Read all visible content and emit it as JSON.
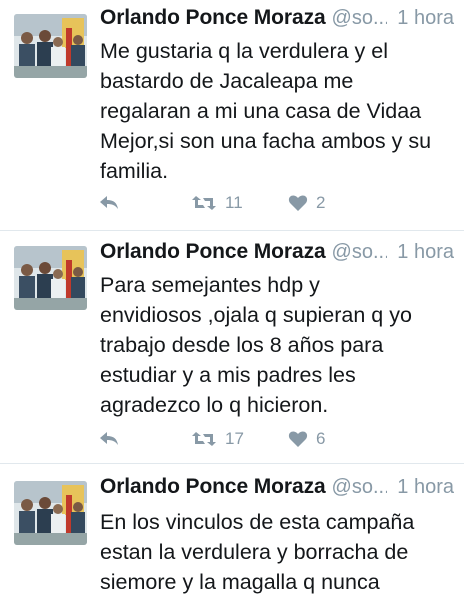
{
  "tweets": [
    {
      "name": "Orlando Ponce Moraza",
      "handle": "@so...",
      "time": "1 hora",
      "lines": [
        "Me gustaria q la verdulera y el",
        "bastardo de Jacaleapa me",
        "regalaran a mi una casa de Vidaa",
        "Mejor,si son una facha ambos y su",
        "familia."
      ],
      "retweets": "11",
      "likes": "2"
    },
    {
      "name": "Orlando Ponce Moraza",
      "handle": "@so...",
      "time": "1 hora",
      "lines": [
        "Para semejantes hdp y",
        "envidiosos ,ojala q supieran q yo",
        "trabajo desde los 8 años para",
        "estudiar y a mis padres les",
        "agradezco lo q hicieron."
      ],
      "retweets": "17",
      "likes": "6"
    },
    {
      "name": "Orlando Ponce Moraza",
      "handle": "@so...",
      "time": "1 hora",
      "lines": [
        "En los vinculos de esta campaña",
        "estan la verdulera y borracha  de",
        "siemore y la magalla  q nunca"
      ]
    }
  ],
  "icons": {
    "reply": "reply-icon",
    "retweet": "retweet-icon",
    "like": "heart-icon"
  },
  "colors": {
    "text": "#14171a",
    "muted": "#8899a6",
    "divider": "#e1e8ed"
  }
}
